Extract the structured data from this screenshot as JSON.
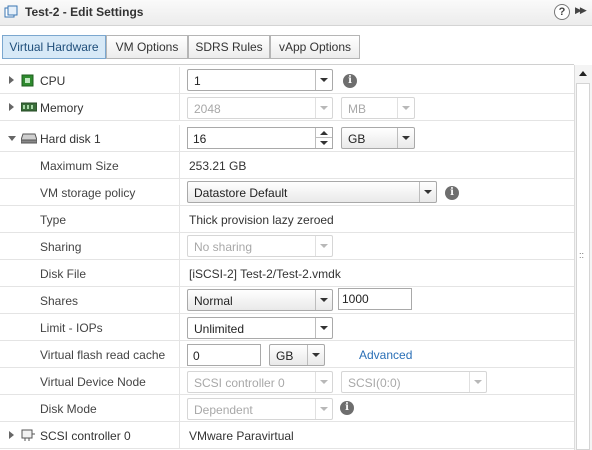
{
  "window": {
    "title": "Test-2 - Edit Settings",
    "help_label": "?",
    "expand_label": "▶▶"
  },
  "tabs": [
    {
      "label": "Virtual Hardware",
      "active": true
    },
    {
      "label": "VM Options",
      "active": false
    },
    {
      "label": "SDRS Rules",
      "active": false
    },
    {
      "label": "vApp Options",
      "active": false
    }
  ],
  "hardware": {
    "cpu": {
      "label": "CPU",
      "value": "1"
    },
    "memory": {
      "label": "Memory",
      "value": "2048",
      "unit": "MB"
    },
    "hard_disk": {
      "label": "Hard disk 1",
      "size": "16",
      "unit": "GB",
      "max_size_label": "Maximum Size",
      "max_size_value": "253.21 GB",
      "storage_policy_label": "VM storage policy",
      "storage_policy_value": "Datastore Default",
      "type_label": "Type",
      "type_value": "Thick provision lazy zeroed",
      "sharing_label": "Sharing",
      "sharing_value": "No sharing",
      "disk_file_label": "Disk File",
      "disk_file_value": "[iSCSI-2] Test-2/Test-2.vmdk",
      "shares_label": "Shares",
      "shares_value": "Normal",
      "shares_number": "1000",
      "limit_label": "Limit - IOPs",
      "limit_value": "Unlimited",
      "flash_label": "Virtual flash read cache",
      "flash_value": "0",
      "flash_unit": "GB",
      "flash_advanced": "Advanced",
      "vdn_label": "Virtual Device Node",
      "vdn_controller": "SCSI controller 0",
      "vdn_slot": "SCSI(0:0)",
      "disk_mode_label": "Disk Mode",
      "disk_mode_value": "Dependent"
    },
    "scsi": {
      "label": "SCSI controller 0",
      "value": "VMware Paravirtual"
    }
  },
  "info_glyph": "i",
  "colors": {
    "accent": "#1f4e7a",
    "active_tab": "#d7e9f7",
    "link": "#2a6fb6",
    "cpu_icon": "#2e8b2e"
  }
}
